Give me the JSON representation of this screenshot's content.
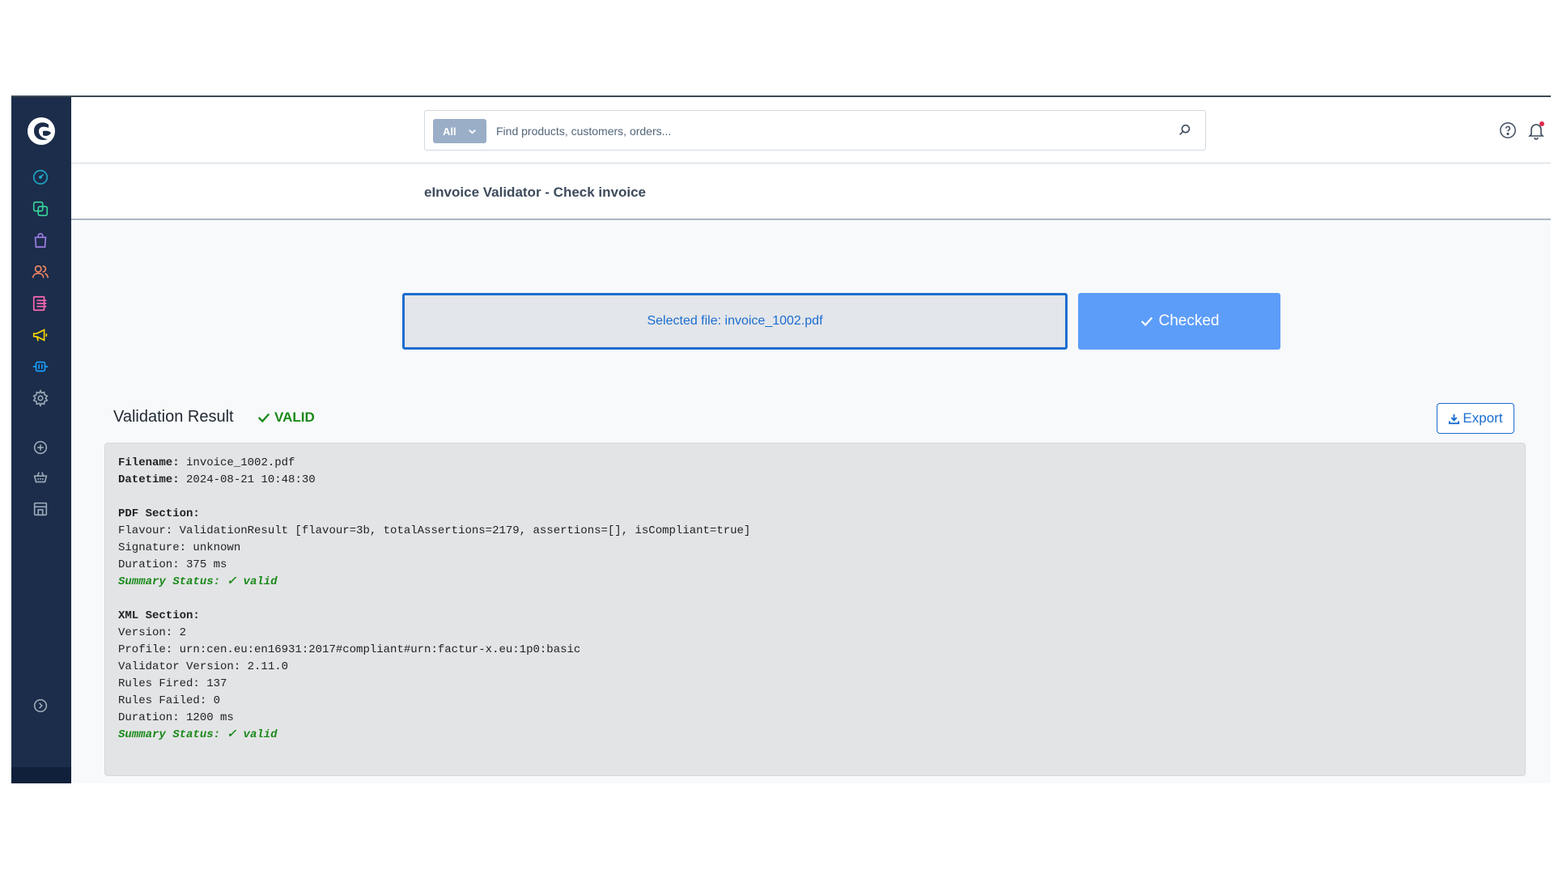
{
  "header": {
    "search": {
      "scope_label": "All",
      "placeholder": "Find products, customers, orders..."
    }
  },
  "sidebar": {
    "items": [
      {
        "name": "dashboard-icon",
        "color": "#1fa6c8"
      },
      {
        "name": "catalogues-icon",
        "color": "#37d29a"
      },
      {
        "name": "orders-icon",
        "color": "#a17ee8"
      },
      {
        "name": "customers-icon",
        "color": "#f88962"
      },
      {
        "name": "content-icon",
        "color": "#ff68b4"
      },
      {
        "name": "marketing-icon",
        "color": "#ffd700"
      },
      {
        "name": "extensions-icon",
        "color": "#189eff"
      },
      {
        "name": "settings-icon",
        "color": "#9aa8b5"
      },
      {
        "name": "add-sales-channel-icon",
        "color": "#9aa8b5"
      },
      {
        "name": "storefront-icon",
        "color": "#9aa8b5"
      },
      {
        "name": "store-icon",
        "color": "#9aa8b5"
      },
      {
        "name": "collapse-icon",
        "color": "#9aa8b5"
      }
    ]
  },
  "page": {
    "title": "eInvoice Validator - Check invoice"
  },
  "upload": {
    "selected_file": "Selected file: invoice_1002.pdf",
    "check_button": "Checked"
  },
  "result": {
    "title": "Validation Result",
    "status_badge": "VALID",
    "export_label": "Export",
    "filename_label": "Filename:",
    "filename_value": " invoice_1002.pdf",
    "datetime_label": "Datetime:",
    "datetime_value": " 2024-08-21 10:48:30",
    "pdf_section_label": "PDF Section:",
    "pdf_flavour": "Flavour: ValidationResult [flavour=3b, totalAssertions=2179, assertions=[], isCompliant=true]",
    "pdf_signature": "Signature: unknown",
    "pdf_duration": "Duration: 375 ms",
    "pdf_summary": "Summary Status: ✓ valid",
    "xml_section_label": "XML Section:",
    "xml_version": "Version: 2",
    "xml_profile": "Profile: urn:cen.eu:en16931:2017#compliant#urn:factur-x.eu:1p0:basic",
    "xml_validator_version": "Validator Version: 2.11.0",
    "xml_rules_fired": "Rules Fired: 137",
    "xml_rules_failed": "Rules Failed: 0",
    "xml_duration": "Duration: 1200 ms",
    "xml_summary": "Summary Status: ✓ valid"
  },
  "colors": {
    "sidebar_bg": "#1b2d4a",
    "primary": "#1c6dd0",
    "valid_green": "#1a8a1a"
  }
}
